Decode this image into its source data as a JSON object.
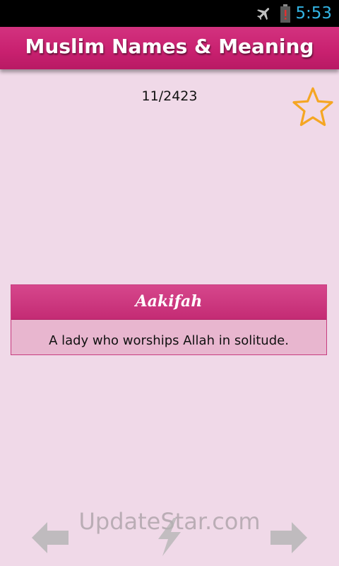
{
  "status_bar": {
    "time": "5:53",
    "icons": [
      "airplane-mode-icon",
      "battery-low-icon"
    ],
    "clock_color": "#33b5e5"
  },
  "header": {
    "title": "Muslim Names & Meaning",
    "color": "#c8206f"
  },
  "counter": "11/2423",
  "favorite": {
    "icon": "star-outline-icon",
    "active": false,
    "color": "#f5a623"
  },
  "name_card": {
    "name": "Aakifah",
    "meaning": "A lady who worships Allah in solitude."
  },
  "watermark": "UpdateStar.com",
  "navigation": {
    "prev_icon": "arrow-left-icon",
    "shuffle_icon": "lightning-icon",
    "next_icon": "arrow-right-icon"
  }
}
